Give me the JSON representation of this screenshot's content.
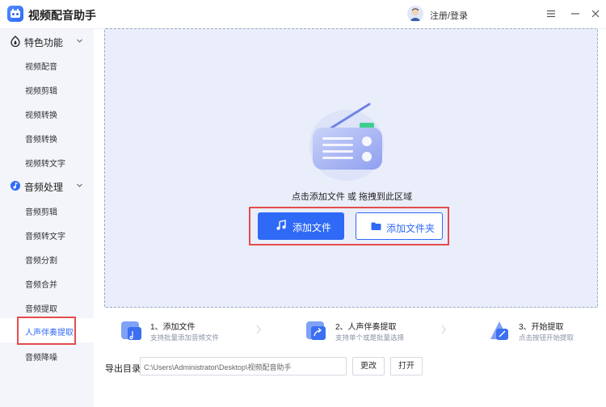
{
  "app": {
    "title": "视频配音助手",
    "login_text": "注册/登录"
  },
  "sidebar": {
    "sections": [
      {
        "label": "特色功能",
        "icon": "sparkle-icon",
        "items": [
          "视频配音",
          "视频剪辑",
          "视频转换",
          "音频转换",
          "视频转文字"
        ]
      },
      {
        "label": "音频处理",
        "icon": "audio-disc-icon",
        "items": [
          "音频剪辑",
          "音频转文字",
          "音频分割",
          "音频合并",
          "音频提取",
          "人声伴奏提取",
          "音频降噪"
        ]
      }
    ],
    "active_item": "人声伴奏提取"
  },
  "dropzone": {
    "hint": "点击添加文件 或 拖拽到此区域",
    "add_file_label": "添加文件",
    "add_folder_label": "添加文件夹"
  },
  "steps": [
    {
      "title": "1、添加文件",
      "desc": "支持批量添加音频文件",
      "icon": "add-file-icon"
    },
    {
      "title": "2、人声伴奏提取",
      "desc": "支持单个或是批量选择",
      "icon": "share-arrow-icon"
    },
    {
      "title": "3、开始提取",
      "desc": "点击按钮开始提取",
      "icon": "start-icon"
    }
  ],
  "export": {
    "label": "导出目录",
    "path": "C:\\Users\\Administrator\\Desktop\\视频配音助手",
    "change_label": "更改",
    "open_label": "打开"
  },
  "colors": {
    "accent": "#2f6af7",
    "highlight_box": "#e64c4c",
    "sidebar_bg": "#f3f5fa",
    "dropzone_bg": "#eaeefb"
  }
}
